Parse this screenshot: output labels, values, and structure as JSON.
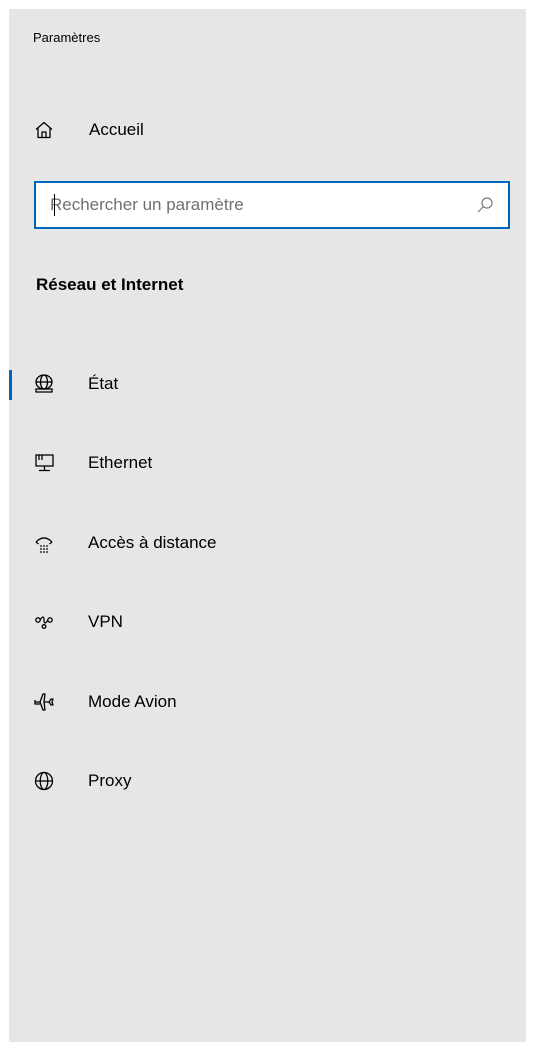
{
  "window": {
    "title": "Paramètres"
  },
  "home": {
    "label": "Accueil",
    "icon": "home-icon"
  },
  "search": {
    "placeholder": "Rechercher un paramètre",
    "value": "",
    "icon": "search-icon"
  },
  "section": {
    "title": "Réseau et Internet"
  },
  "nav": {
    "items": [
      {
        "label": "État",
        "icon": "globe-status-icon",
        "selected": true
      },
      {
        "label": "Ethernet",
        "icon": "ethernet-icon",
        "selected": false
      },
      {
        "label": "Accès à distance",
        "icon": "dial-up-icon",
        "selected": false
      },
      {
        "label": "VPN",
        "icon": "vpn-icon",
        "selected": false
      },
      {
        "label": "Mode Avion",
        "icon": "airplane-icon",
        "selected": false
      },
      {
        "label": "Proxy",
        "icon": "globe-icon",
        "selected": false
      }
    ]
  },
  "colors": {
    "panel_background": "#e6e6e6",
    "accent": "#0067c0",
    "placeholder": "#707070"
  }
}
